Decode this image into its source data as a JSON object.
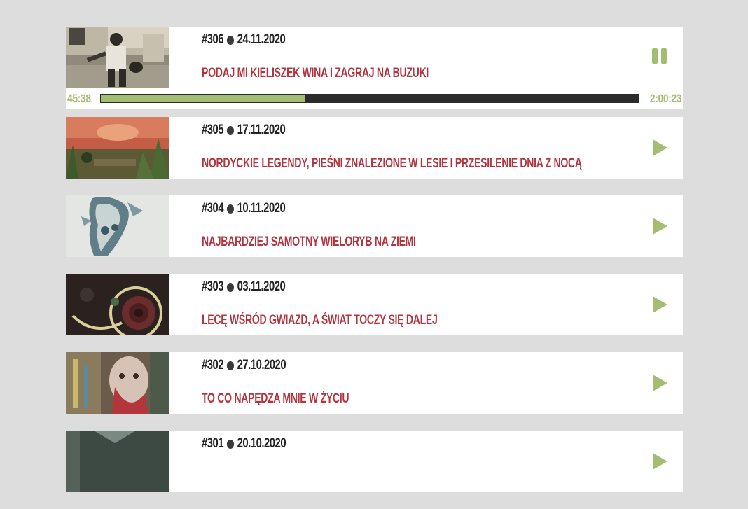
{
  "colors": {
    "background": "#dddddd",
    "card": "#ffffff",
    "title": "#b3343f",
    "accent": "#a3bd72",
    "text": "#222222"
  },
  "episodes": [
    {
      "number": "#306",
      "date": "24.11.2020",
      "title": "PODAJ MI KIELISZEK WINA I ZAGRAJ NA BUZUKI",
      "control_icon": "pause-icon",
      "playing": true,
      "elapsed": "45:38",
      "duration": "2:00:23",
      "progress_fraction": 0.379
    },
    {
      "number": "#305",
      "date": "17.11.2020",
      "title": "NORDYCKIE LEGENDY, PIEŚNI ZNALEZIONE W LESIE I PRZESILENIE DNIA Z NOCĄ",
      "control_icon": "play-icon",
      "playing": false
    },
    {
      "number": "#304",
      "date": "10.11.2020",
      "title": "NAJBARDZIEJ SAMOTNY WIELORYB NA ZIEMI",
      "control_icon": "play-icon",
      "playing": false
    },
    {
      "number": "#303",
      "date": "03.11.2020",
      "title": "LECĘ WŚRÓD GWIAZD, A ŚWIAT TOCZY SIĘ DALEJ",
      "control_icon": "play-icon",
      "playing": false
    },
    {
      "number": "#302",
      "date": "27.10.2020",
      "title": "TO CO NAPĘDZA MNIE W ŻYCIU",
      "control_icon": "play-icon",
      "playing": false
    },
    {
      "number": "#301",
      "date": "20.10.2020",
      "title": "",
      "control_icon": "play-icon",
      "playing": false
    }
  ]
}
